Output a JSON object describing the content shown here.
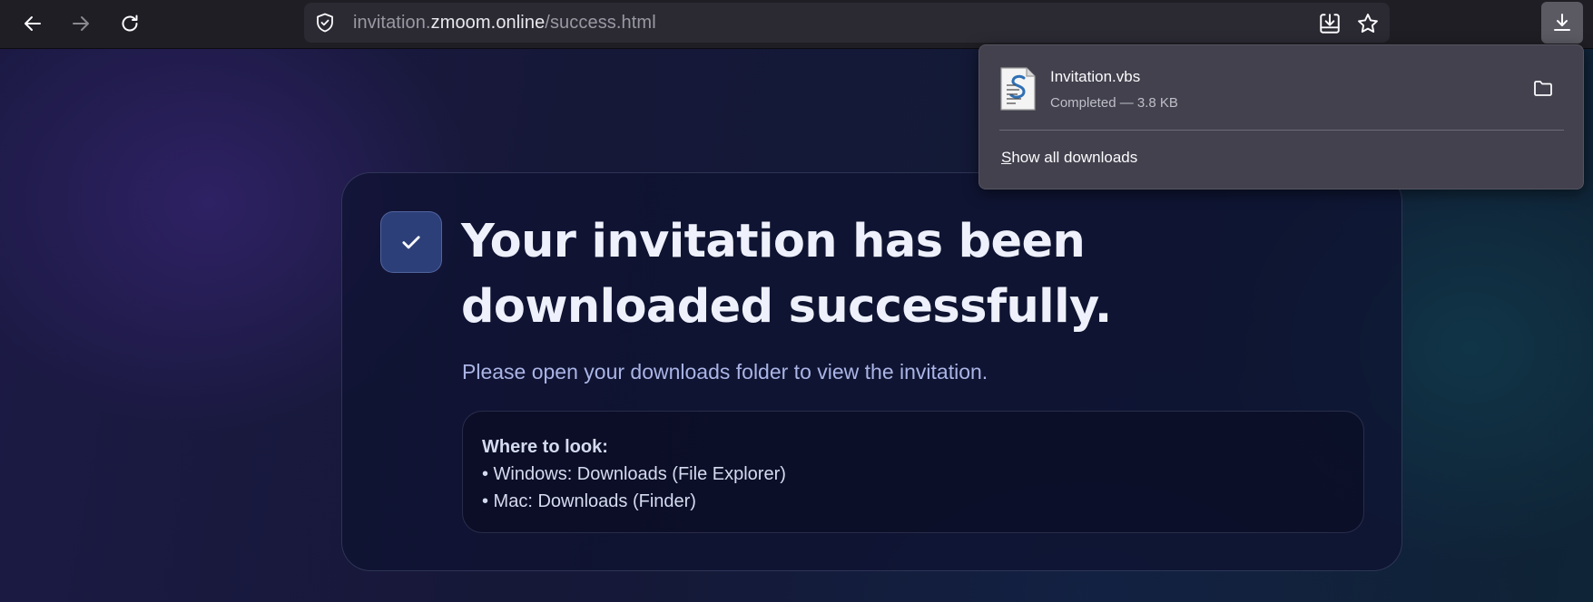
{
  "browser": {
    "url": {
      "prefix": "invitation.",
      "domain": "zmoom.online",
      "path": "/success.html"
    }
  },
  "page": {
    "heading": "Your invitation has been downloaded successfully.",
    "subtext": "Please open your downloads folder to view the invitation.",
    "info": {
      "title": "Where to look:",
      "lines": [
        "• Windows: Downloads (File Explorer)",
        "• Mac: Downloads (Finder)"
      ]
    }
  },
  "downloads_panel": {
    "file_name": "Invitation.vbs",
    "status": "Completed — 3.8 KB",
    "show_all_accesskey": "S",
    "show_all_rest": "how all downloads"
  },
  "colors": {
    "accent_check_badge": "#2d3f78",
    "toolbar": "#1f1e24",
    "urlbar": "#2b2a33",
    "panel": "#42414d"
  },
  "icons": {
    "back": "arrow-left-icon",
    "forward": "arrow-right-icon",
    "reload": "reload-icon",
    "security": "shield-check-icon",
    "save_page": "save-to-disk-icon",
    "bookmark": "star-icon",
    "downloads": "download-icon",
    "check": "checkmark-icon",
    "script_file": "script-file-icon",
    "folder": "folder-icon"
  }
}
